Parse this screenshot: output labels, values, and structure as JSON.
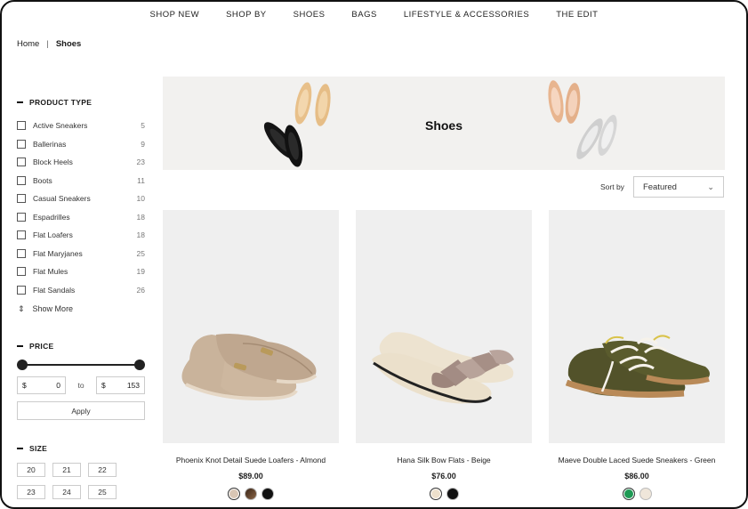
{
  "nav": [
    "SHOP NEW",
    "SHOP BY",
    "SHOES",
    "BAGS",
    "LIFESTYLE & ACCESSORIES",
    "THE EDIT"
  ],
  "breadcrumb": {
    "home": "Home",
    "separator": "|",
    "current": "Shoes"
  },
  "filters": {
    "product_type": {
      "title": "PRODUCT TYPE",
      "items": [
        {
          "label": "Active Sneakers",
          "count": "5"
        },
        {
          "label": "Ballerinas",
          "count": "9"
        },
        {
          "label": "Block Heels",
          "count": "23"
        },
        {
          "label": "Boots",
          "count": "11"
        },
        {
          "label": "Casual Sneakers",
          "count": "10"
        },
        {
          "label": "Espadrilles",
          "count": "18"
        },
        {
          "label": "Flat Loafers",
          "count": "18"
        },
        {
          "label": "Flat Maryjanes",
          "count": "25"
        },
        {
          "label": "Flat Mules",
          "count": "19"
        },
        {
          "label": "Flat Sandals",
          "count": "26"
        }
      ],
      "show_more": "Show More"
    },
    "price": {
      "title": "PRICE",
      "currency": "$",
      "min": "0",
      "max": "153",
      "to_label": "to",
      "apply_label": "Apply"
    },
    "size": {
      "title": "SIZE",
      "options": [
        "20",
        "21",
        "22",
        "23",
        "24",
        "25"
      ]
    }
  },
  "banner": {
    "title": "Shoes"
  },
  "sort": {
    "label": "Sort by",
    "value": "Featured"
  },
  "products": [
    {
      "name": "Phoenix Knot Detail Suede Loafers - Almond",
      "price": "$89.00",
      "swatches": [
        "#d9c6b4",
        "#6b4a33",
        "#111111"
      ]
    },
    {
      "name": "Hana Silk Bow Flats - Beige",
      "price": "$76.00",
      "swatches": [
        "#ede0cc",
        "#111111"
      ]
    },
    {
      "name": "Maeve Double Laced Suede Sneakers - Green",
      "price": "$86.00",
      "swatches": [
        "#1f9a55",
        "#efe6da"
      ]
    }
  ]
}
